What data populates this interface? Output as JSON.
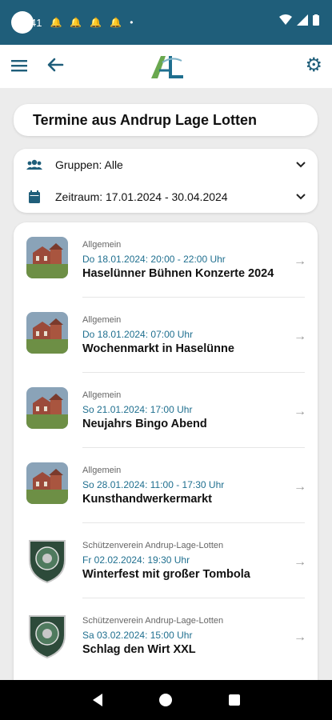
{
  "status": {
    "time": "41",
    "notification_icons": [
      "bell-icon",
      "bell-icon",
      "bell-icon",
      "bell-icon"
    ],
    "dot": "•"
  },
  "header": {
    "logo_text": "AL"
  },
  "page_title": "Termine aus Andrup Lage Lotten",
  "filters": {
    "groups_label": "Gruppen: Alle",
    "period_label": "Zeitraum: 17.01.2024 - 30.04.2024"
  },
  "events": [
    {
      "category": "Allgemein",
      "date": "Do 18.01.2024: 20:00 - 22:00 Uhr",
      "title": "Haselünner Bühnen Konzerte 2024",
      "image": "church-photo"
    },
    {
      "category": "Allgemein",
      "date": "Do 18.01.2024: 07:00 Uhr",
      "title": "Wochenmarkt in Haselünne",
      "image": "church-photo"
    },
    {
      "category": "Allgemein",
      "date": "So 21.01.2024: 17:00 Uhr",
      "title": "Neujahrs Bingo Abend",
      "image": "church-photo"
    },
    {
      "category": "Allgemein",
      "date": "So 28.01.2024: 11:00 - 17:30 Uhr",
      "title": "Kunsthandwerkermarkt",
      "image": "church-photo"
    },
    {
      "category": "Schützenverein Andrup-Lage-Lotten",
      "date": "Fr 02.02.2024: 19:30 Uhr",
      "title": "Winterfest mit großer Tombola",
      "image": "club-badge"
    },
    {
      "category": "Schützenverein Andrup-Lage-Lotten",
      "date": "Sa 03.02.2024: 15:00 Uhr",
      "title": "Schlag den Wirt XXL",
      "image": "club-badge"
    }
  ],
  "colors": {
    "primary": "#1f5e7a",
    "date_text": "#1f6f8f",
    "background": "#ececec"
  }
}
